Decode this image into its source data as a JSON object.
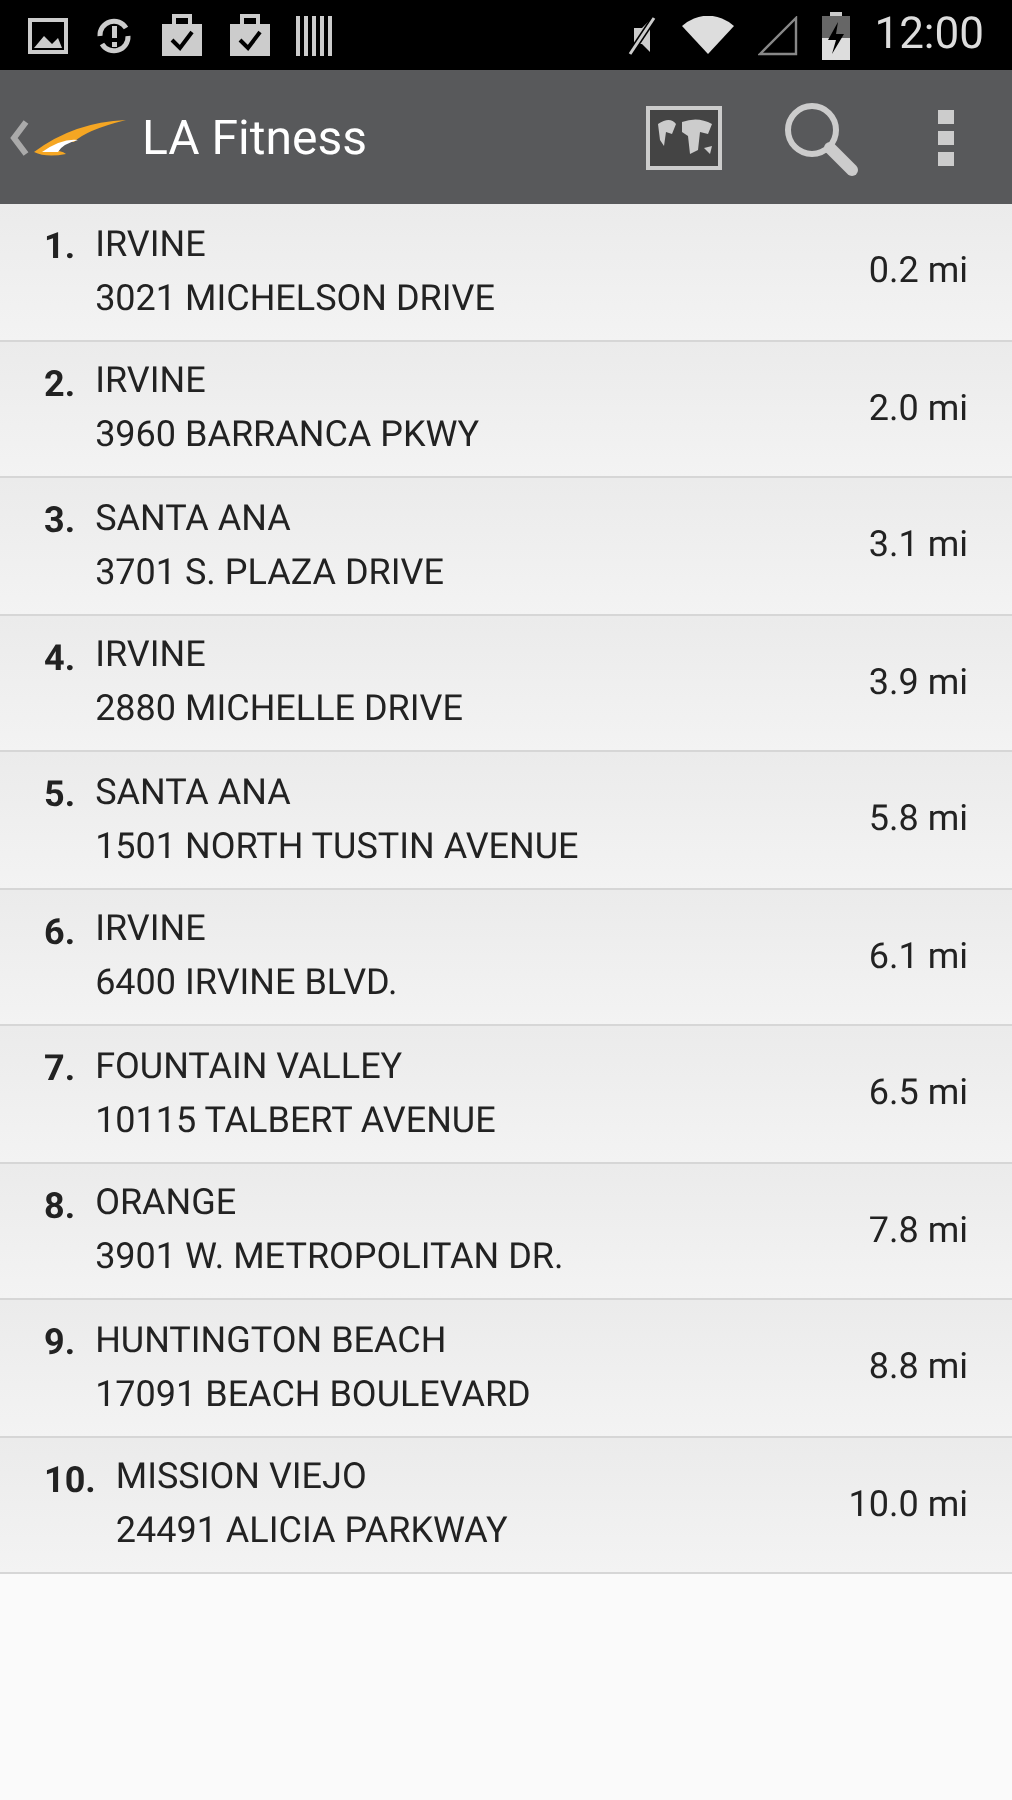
{
  "status_bar": {
    "time": "12:00"
  },
  "action_bar": {
    "title": "LA Fitness"
  },
  "locations": [
    {
      "number": "1.",
      "city": "IRVINE",
      "address": "3021 MICHELSON DRIVE",
      "distance": "0.2 mi"
    },
    {
      "number": "2.",
      "city": "IRVINE",
      "address": "3960 BARRANCA PKWY",
      "distance": "2.0 mi"
    },
    {
      "number": "3.",
      "city": "SANTA ANA",
      "address": "3701 S. PLAZA DRIVE",
      "distance": "3.1 mi"
    },
    {
      "number": "4.",
      "city": "IRVINE",
      "address": "2880 MICHELLE DRIVE",
      "distance": "3.9 mi"
    },
    {
      "number": "5.",
      "city": "SANTA ANA",
      "address": "1501 NORTH TUSTIN AVENUE",
      "distance": "5.8 mi"
    },
    {
      "number": "6.",
      "city": "IRVINE",
      "address": "6400 IRVINE BLVD.",
      "distance": "6.1 mi"
    },
    {
      "number": "7.",
      "city": "FOUNTAIN VALLEY",
      "address": "10115 TALBERT AVENUE",
      "distance": "6.5 mi"
    },
    {
      "number": "8.",
      "city": "ORANGE",
      "address": "3901 W. METROPOLITAN DR.",
      "distance": "7.8 mi"
    },
    {
      "number": "9.",
      "city": "HUNTINGTON BEACH",
      "address": "17091 BEACH BOULEVARD",
      "distance": "8.8 mi"
    },
    {
      "number": "10.",
      "city": "MISSION VIEJO",
      "address": "24491 ALICIA PARKWAY",
      "distance": "10.0 mi"
    }
  ]
}
